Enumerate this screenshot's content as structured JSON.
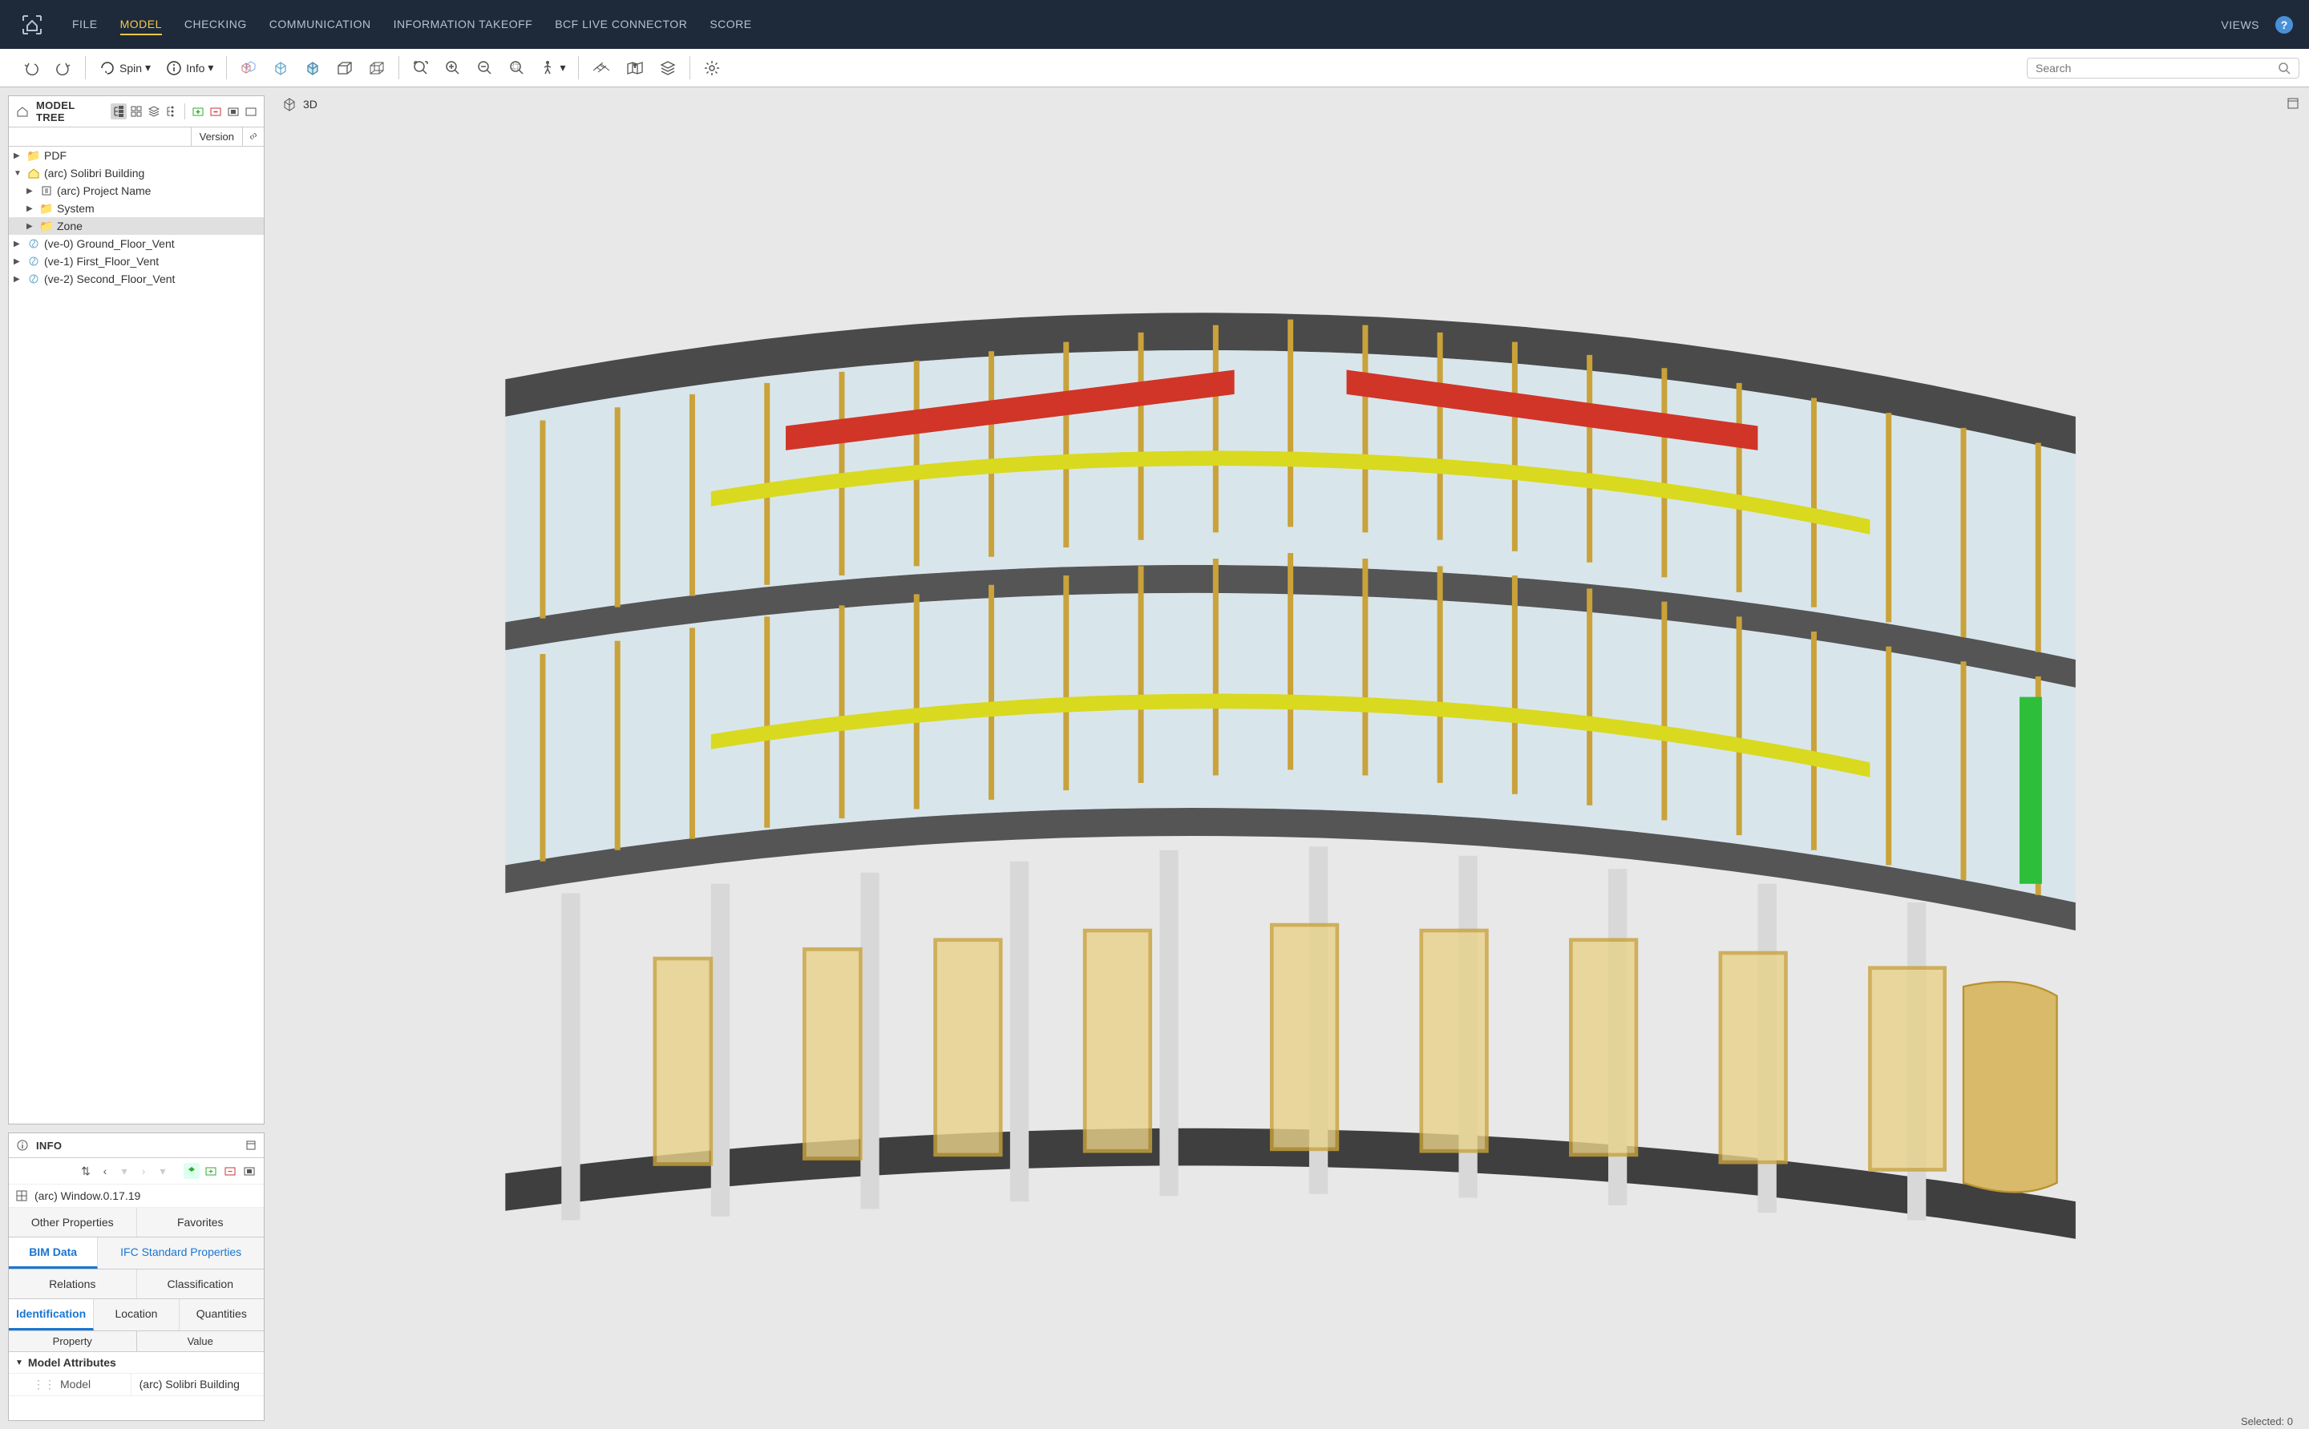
{
  "menu": {
    "items": [
      "FILE",
      "MODEL",
      "CHECKING",
      "COMMUNICATION",
      "INFORMATION TAKEOFF",
      "BCF LIVE CONNECTOR",
      "SCORE"
    ],
    "active_index": 1,
    "views": "VIEWS"
  },
  "toolbar": {
    "spin": "Spin",
    "info": "Info",
    "search_placeholder": "Search"
  },
  "model_tree": {
    "title": "MODEL TREE",
    "version_col": "Version",
    "items": [
      {
        "label": "PDF",
        "level": 0,
        "expanded": false,
        "icon": "folder"
      },
      {
        "label": "(arc) Solibri Building",
        "level": 0,
        "expanded": true,
        "icon": "building"
      },
      {
        "label": "(arc) Project Name",
        "level": 1,
        "expanded": false,
        "icon": "project"
      },
      {
        "label": "System",
        "level": 1,
        "expanded": false,
        "icon": "folder"
      },
      {
        "label": "Zone",
        "level": 1,
        "expanded": false,
        "icon": "folder",
        "selected": true
      },
      {
        "label": "(ve-0) Ground_Floor_Vent",
        "level": 0,
        "expanded": false,
        "icon": "vent"
      },
      {
        "label": "(ve-1) First_Floor_Vent",
        "level": 0,
        "expanded": false,
        "icon": "vent"
      },
      {
        "label": "(ve-2) Second_Floor_Vent",
        "level": 0,
        "expanded": false,
        "icon": "vent"
      }
    ]
  },
  "info_panel": {
    "title": "INFO",
    "component": "(arc) Window.0.17.19",
    "tabs_row1": [
      "Other Properties",
      "Favorites"
    ],
    "tabs_row2": [
      "BIM Data",
      "IFC Standard Properties"
    ],
    "tabs_row2_active": 0,
    "tabs_row3": [
      "Relations",
      "Classification"
    ],
    "tabs_row4": [
      "Identification",
      "Location",
      "Quantities"
    ],
    "tabs_row4_active": 0,
    "props": {
      "header": [
        "Property",
        "Value"
      ],
      "group": "Model Attributes",
      "rows": [
        {
          "name": "Model",
          "value": "(arc) Solibri Building"
        }
      ]
    }
  },
  "viewport": {
    "label": "3D",
    "status": "Selected: 0"
  }
}
